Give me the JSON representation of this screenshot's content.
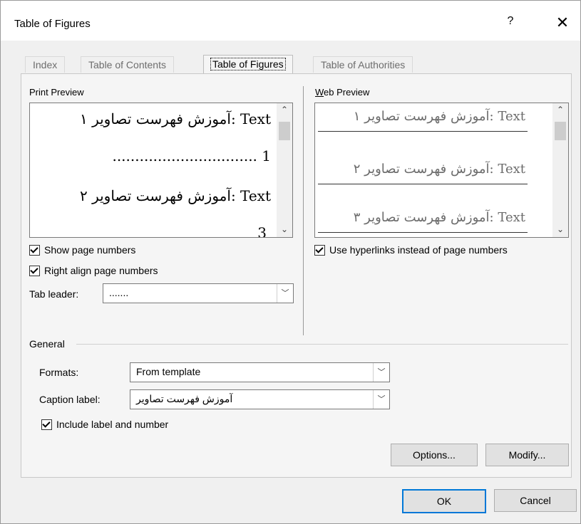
{
  "window": {
    "title": "Table of Figures",
    "help": "?",
    "close": "✕"
  },
  "tabs": [
    {
      "label": "Index"
    },
    {
      "label": "Table of Contents"
    },
    {
      "label": "Table of Figures",
      "active": true
    },
    {
      "label": "Table of Authorities"
    }
  ],
  "print_preview": {
    "label": "Print Preview",
    "lines": [
      "Text :آموزش فهرست تصاویر ۱",
      "................................ 1",
      "Text :آموزش فهرست تصاویر ۲",
      "3"
    ]
  },
  "web_preview": {
    "label": "Web Preview",
    "lines": [
      "Text :آموزش فهرست تصاویر ۱",
      "Text :آموزش فهرست تصاویر ۲",
      "Text :آموزش فهرست تصاویر ۳"
    ]
  },
  "options": {
    "show_page_numbers": {
      "label": "Show page numbers",
      "checked": true
    },
    "right_align": {
      "label": "Right align page numbers",
      "checked": true
    },
    "use_hyperlinks": {
      "label": "Use hyperlinks instead of page numbers",
      "checked": true
    },
    "tab_leader": {
      "label": "Tab leader:",
      "value": "......."
    }
  },
  "general": {
    "label": "General",
    "formats": {
      "label": "Formats:",
      "value": "From template"
    },
    "caption_label": {
      "label": "Caption label:",
      "value": "آموزش فهرست تصاویر"
    },
    "include_label": {
      "label": "Include label and number",
      "checked": true
    }
  },
  "buttons": {
    "options": "Options...",
    "modify": "Modify...",
    "ok": "OK",
    "cancel": "Cancel"
  },
  "icons": {
    "help": "question-icon",
    "close": "close-icon",
    "dropdown": "chevron-down-icon",
    "checkbox": "checkmark-icon"
  }
}
